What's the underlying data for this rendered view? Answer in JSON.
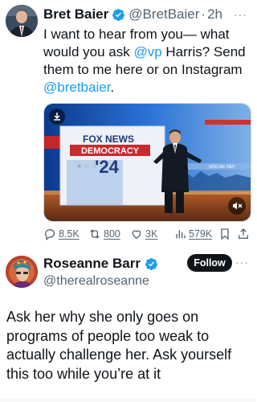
{
  "tweet1": {
    "author_name": "Bret Baier",
    "handle": "@BretBaier",
    "separator": "·",
    "time": "2h",
    "more_icon": "more-dots-icon",
    "text_parts": {
      "a": "I want to hear from you— what would you ask ",
      "mention1": "@vp",
      "b": " Harris? Send them to me here or on Instagram ",
      "mention2": "@bretbaier",
      "c": "."
    },
    "media": {
      "screen_title_line1": "FOX NEWS",
      "screen_title_line2": "DEMOCRACY",
      "screen_title_line3": "'24",
      "ticker": "SPECIAL REP"
    },
    "actions": {
      "replies": "8.5K",
      "reposts": "800",
      "likes": "3K",
      "views": "579K"
    }
  },
  "tweet2": {
    "author_name": "Roseanne Barr",
    "handle": "@therealroseanne",
    "follow_label": "Follow",
    "text": "Ask her why she only goes on programs of people too weak to actually challenge her. Ask yourself this too while you’re at it"
  },
  "colors": {
    "accent": "#1d9bf0",
    "text": "#0f1419",
    "muted": "#536471",
    "verified": "#1d9bf0"
  }
}
